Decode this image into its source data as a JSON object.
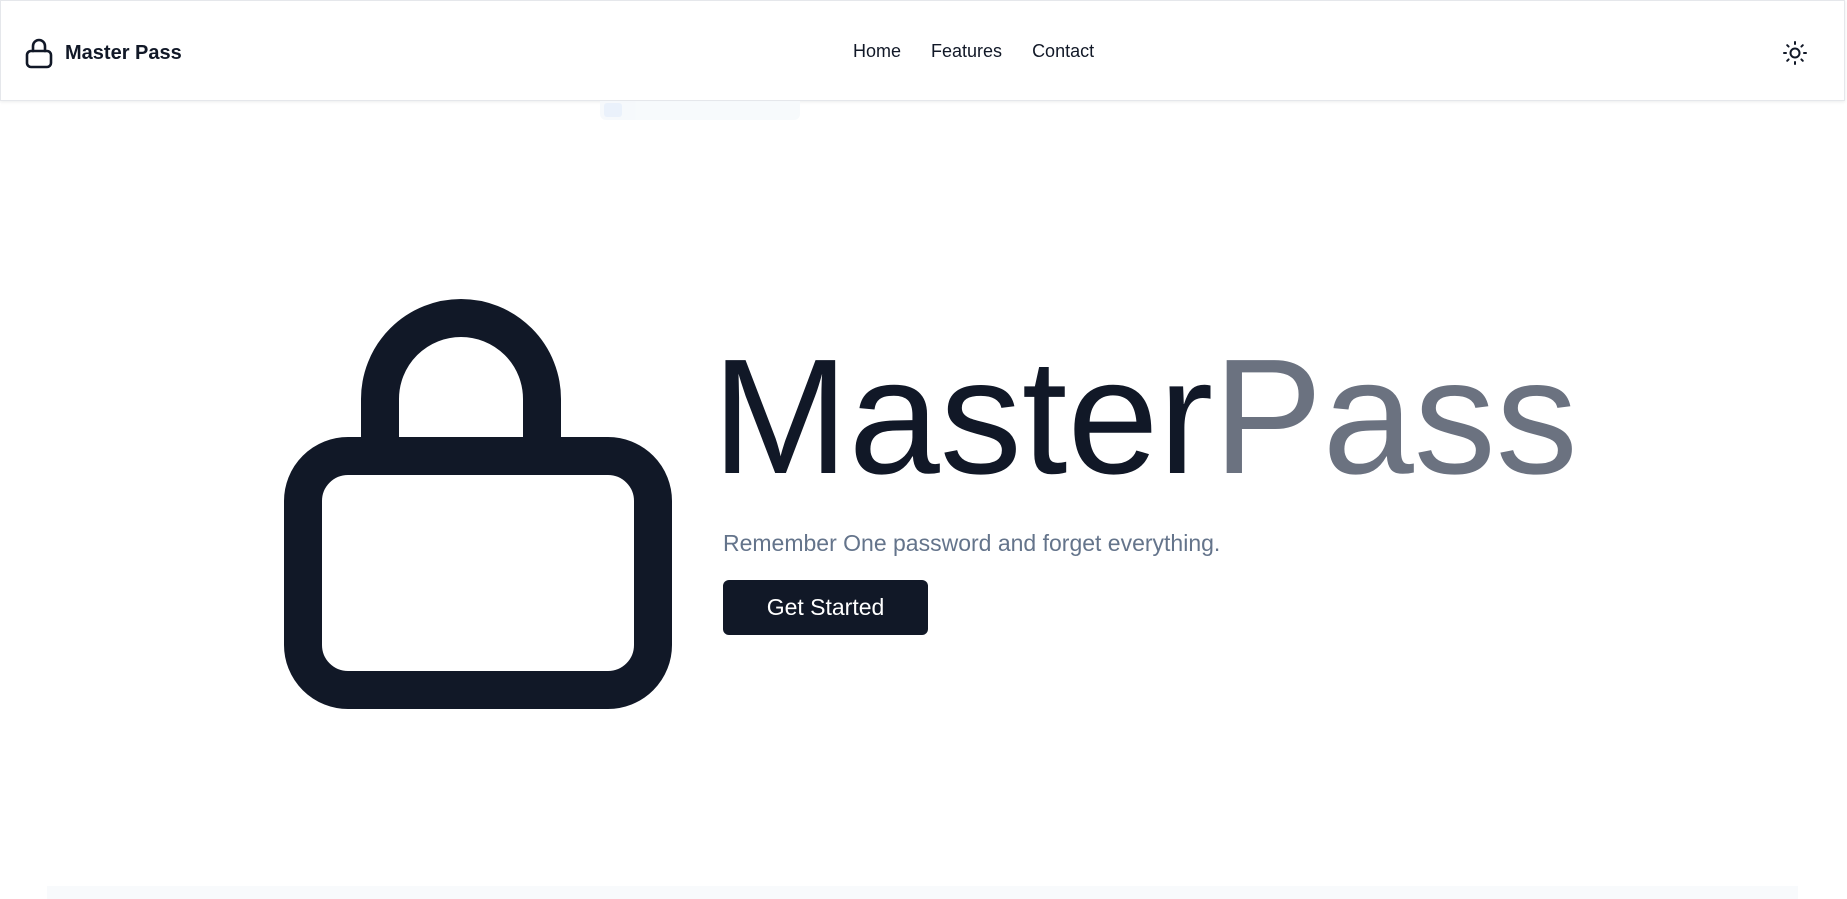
{
  "header": {
    "brand_name": "Master Pass",
    "nav": [
      {
        "label": "Home"
      },
      {
        "label": "Features"
      },
      {
        "label": "Contact"
      }
    ],
    "theme_toggle_icon": "sun-icon"
  },
  "hero": {
    "title_part1": "Master",
    "title_part2": "Pass",
    "subtitle": "Remember One password and forget everything.",
    "cta_label": "Get Started",
    "icon": "lock-icon"
  },
  "colors": {
    "primary": "#111827",
    "muted_title": "#6b7280",
    "subtitle": "#64748b",
    "background": "#ffffff"
  }
}
